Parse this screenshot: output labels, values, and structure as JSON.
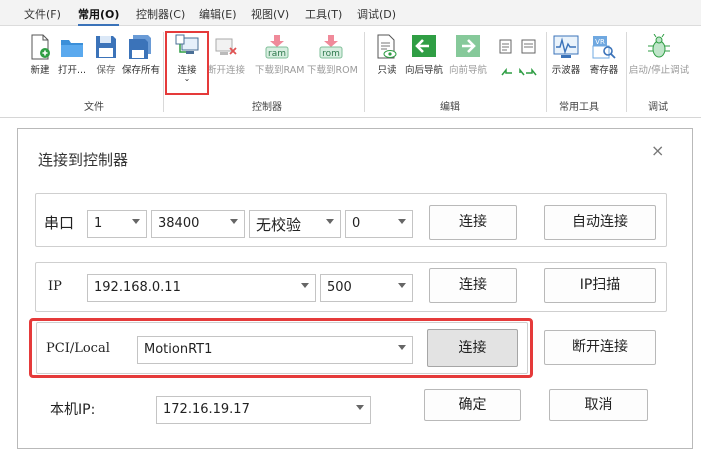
{
  "ribbon": {
    "menu": [
      "文件(F)",
      "常用(O)",
      "控制器(C)",
      "编辑(E)",
      "视图(V)",
      "工具(T)",
      "调试(D)"
    ],
    "tools": {
      "new": "新建",
      "open": "打开...",
      "save": "保存",
      "save_all": "保存所有",
      "connect": "连接",
      "disconnect": "断开连接",
      "download_ram": "下载到RAM",
      "download_rom": "下载到ROM",
      "readonly": "只读",
      "nav_back": "向后导航",
      "nav_forward": "向前导航",
      "oscilloscope": "示波器",
      "register": "寄存器",
      "start_stop_debug": "启动/停止调试",
      "ram_badge": "ram",
      "rom_badge": "rom",
      "vr_badge": "VR"
    },
    "groups": {
      "file": "文件",
      "controller": "控制器",
      "edit": "编辑",
      "common_tools": "常用工具",
      "debug": "调试"
    }
  },
  "dialog": {
    "title": "连接到控制器",
    "close": "×",
    "serial": {
      "label": "串口",
      "port": "1",
      "baud": "38400",
      "parity": "无校验",
      "stop": "0",
      "connect": "连接",
      "auto_connect": "自动连接"
    },
    "ip": {
      "label": "IP",
      "address": "192.168.0.11",
      "port": "500",
      "connect": "连接",
      "scan": "IP扫描"
    },
    "pci": {
      "label": "PCI/Local",
      "target": "MotionRT1",
      "connect": "连接",
      "disconnect": "断开连接"
    },
    "local_ip": {
      "label": "本机IP:",
      "value": "172.16.19.17"
    },
    "ok": "确定",
    "cancel": "取消"
  },
  "colors": {
    "highlight": "#e53a3a",
    "accent_blue": "#3b73b9",
    "green": "#2f9e44"
  }
}
